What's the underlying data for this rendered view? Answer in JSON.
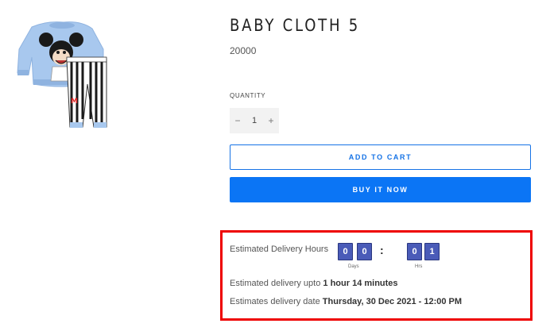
{
  "product": {
    "title": "BABY CLOTH 5",
    "price": "20000",
    "image_icon": "baby-clothing-set-image"
  },
  "quantity": {
    "label": "QUANTITY",
    "minus": "−",
    "value": "1",
    "plus": "+"
  },
  "buttons": {
    "add_to_cart": "ADD TO CART",
    "buy_now": "BUY IT NOW"
  },
  "delivery": {
    "hours_label": "Estimated Delivery Hours",
    "digits": [
      "0",
      "0",
      "0",
      "1"
    ],
    "separator": ":",
    "days_label": "Days",
    "hrs_label": "Hrs",
    "upto_prefix": "Estimated delivery upto",
    "upto_value": "1 hour 14 minutes",
    "date_prefix": "Estimates delivery date",
    "date_value": "Thursday, 30 Dec 2021 - 12:00 PM"
  },
  "colors": {
    "accent": "#0b75f5",
    "highlight_border": "#ee0000",
    "digit_bg": "#4a5bb8"
  }
}
